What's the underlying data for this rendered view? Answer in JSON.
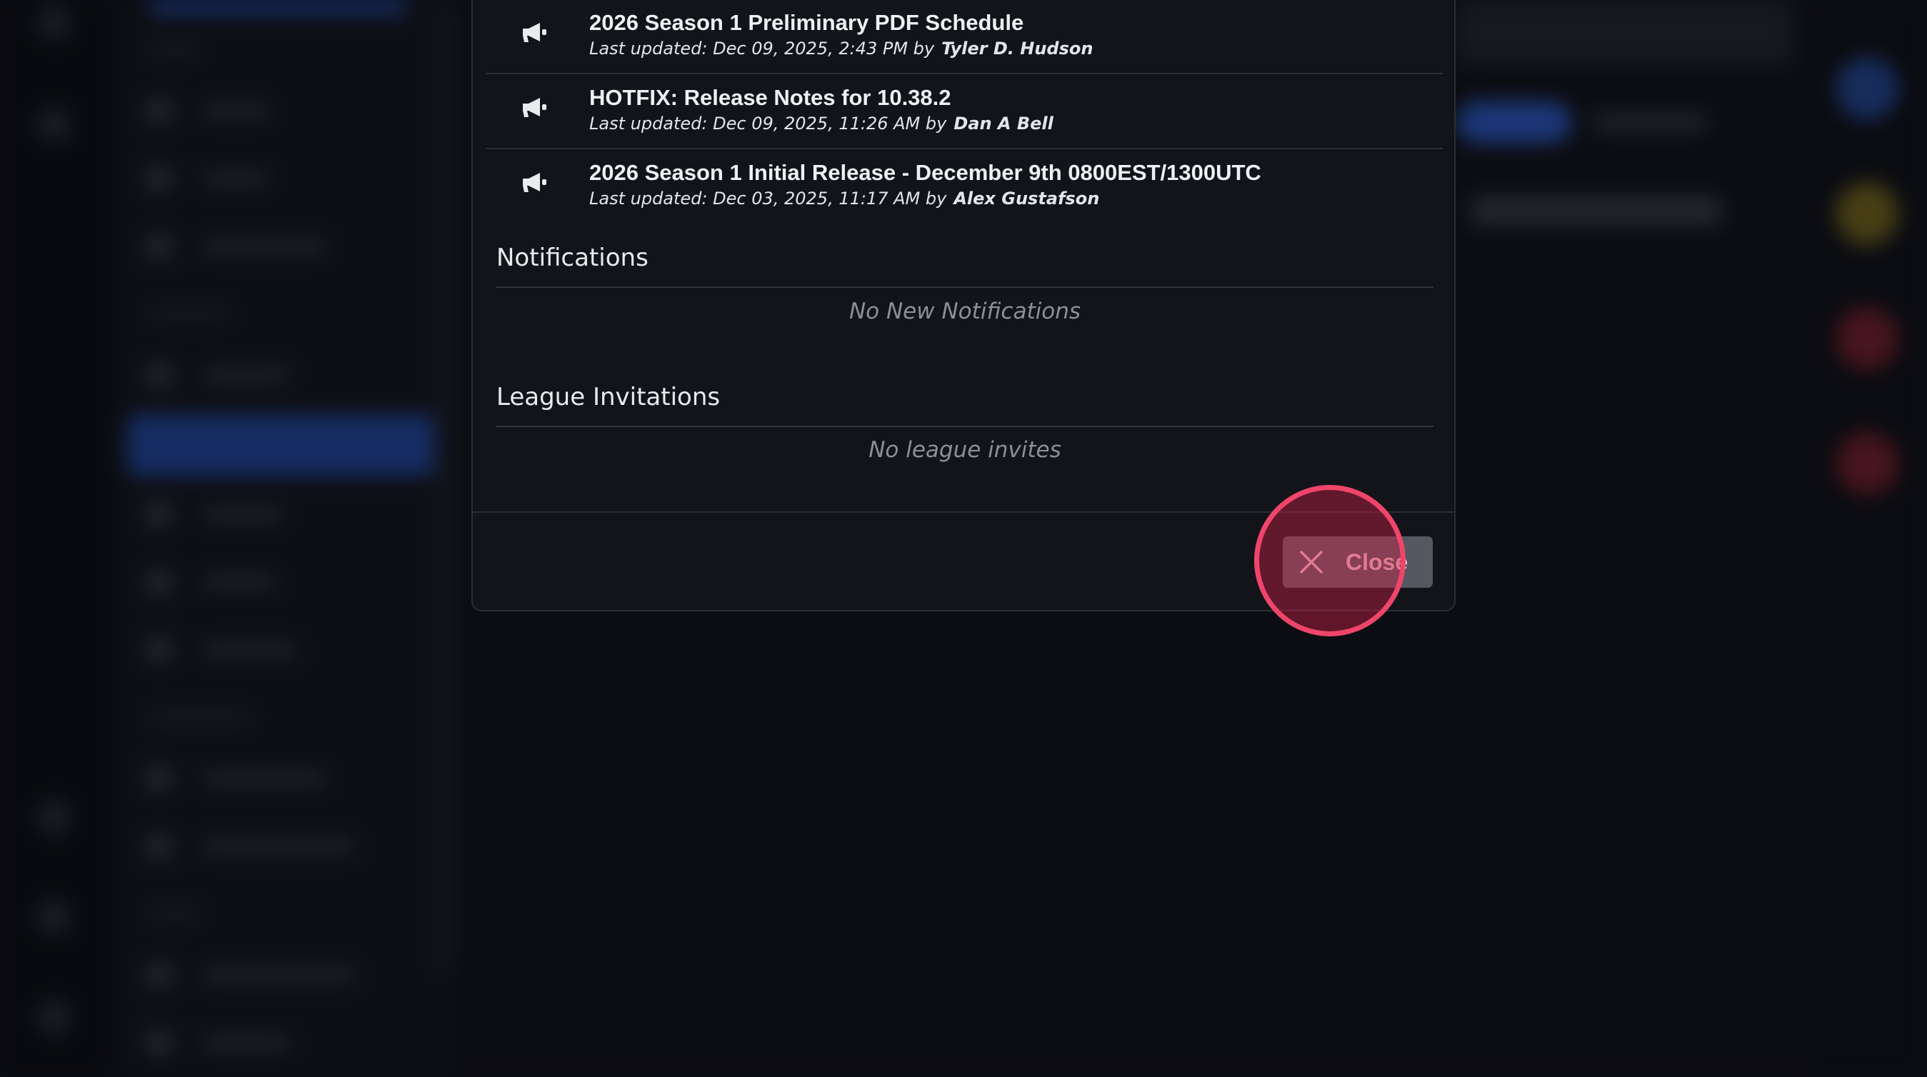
{
  "announcements": [
    {
      "title": "2026 Season 1 Preliminary PDF Schedule",
      "meta_prefix": "Last updated: Dec 09, 2025, 2:43 PM by",
      "author": "Tyler D. Hudson"
    },
    {
      "title": "HOTFIX: Release Notes for 10.38.2",
      "meta_prefix": "Last updated: Dec 09, 2025, 11:26 AM by",
      "author": "Dan A Bell"
    },
    {
      "title": "2026 Season 1 Initial Release - December 9th 0800EST/1300UTC",
      "meta_prefix": "Last updated: Dec 03, 2025, 11:17 AM by",
      "author": "Alex Gustafson"
    }
  ],
  "notifications": {
    "title": "Notifications",
    "empty_text": "No New Notifications"
  },
  "league_invitations": {
    "title": "League Invitations",
    "empty_text": "No league invites"
  },
  "footer": {
    "close_label": "Close"
  },
  "colors": {
    "modal_bg": "#121419",
    "close_button_bg": "#555860",
    "click_indicator": "#f0456a"
  },
  "icons": {
    "announcement": "megaphone-icon",
    "close": "close-icon"
  }
}
